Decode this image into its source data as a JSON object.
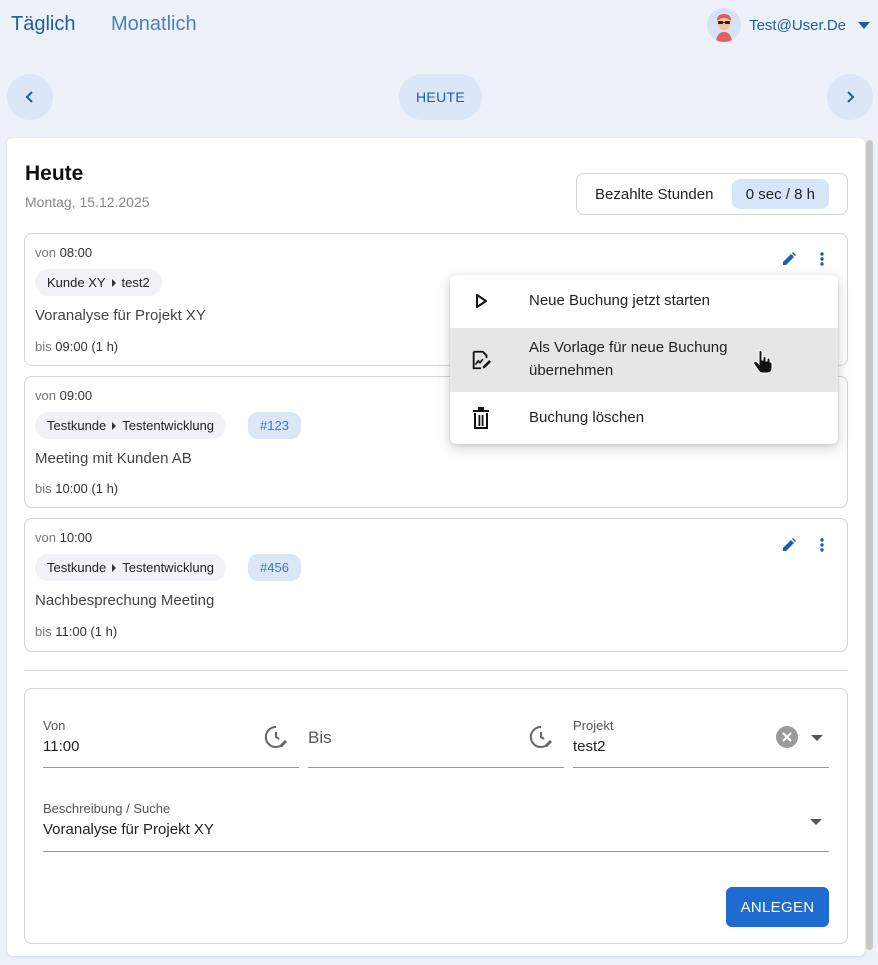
{
  "header": {
    "tabs": [
      {
        "label": "Täglich"
      },
      {
        "label": "Monatlich"
      }
    ],
    "user": {
      "email": "Test@User.De"
    }
  },
  "nav": {
    "today_label": "HEUTE"
  },
  "day": {
    "title": "Heute",
    "date": "Montag, 15.12.2025",
    "paid_label": "Bezahlte Stunden",
    "paid_value": "0 sec / 8 h"
  },
  "entries": [
    {
      "from_prefix": "von",
      "from": "08:00",
      "customer": "Kunde XY",
      "project": "test2",
      "tag": "",
      "description": "Voranalyse für Projekt XY",
      "to_prefix": "bis",
      "to": "09:00 (1 h)"
    },
    {
      "from_prefix": "von",
      "from": "09:00",
      "customer": "Testkunde",
      "project": "Testentwicklung",
      "tag": "#123",
      "description": "Meeting mit Kunden AB",
      "to_prefix": "bis",
      "to": "10:00 (1 h)"
    },
    {
      "from_prefix": "von",
      "from": "10:00",
      "customer": "Testkunde",
      "project": "Testentwicklung",
      "tag": "#456",
      "description": "Nachbesprechung Meeting",
      "to_prefix": "bis",
      "to": "11:00 (1 h)"
    }
  ],
  "context_menu": {
    "items": [
      {
        "label": "Neue Buchung jetzt starten",
        "icon": "play-icon"
      },
      {
        "label": "Als Vorlage für neue Buchung übernehmen",
        "icon": "template-icon"
      },
      {
        "label": "Buchung löschen",
        "icon": "trash-icon"
      }
    ]
  },
  "form": {
    "von_label": "Von",
    "von_value": "11:00",
    "bis_placeholder": "Bis",
    "projekt_label": "Projekt",
    "projekt_value": "test2",
    "beschreibung_label": "Beschreibung / Suche",
    "beschreibung_value": "Voranalyse für Projekt XY",
    "submit_label": "ANLEGEN"
  },
  "colors": {
    "accent": "#1e6ccf",
    "nav_bg": "#edf1f9",
    "chip_tag": "#dbe7f6"
  }
}
